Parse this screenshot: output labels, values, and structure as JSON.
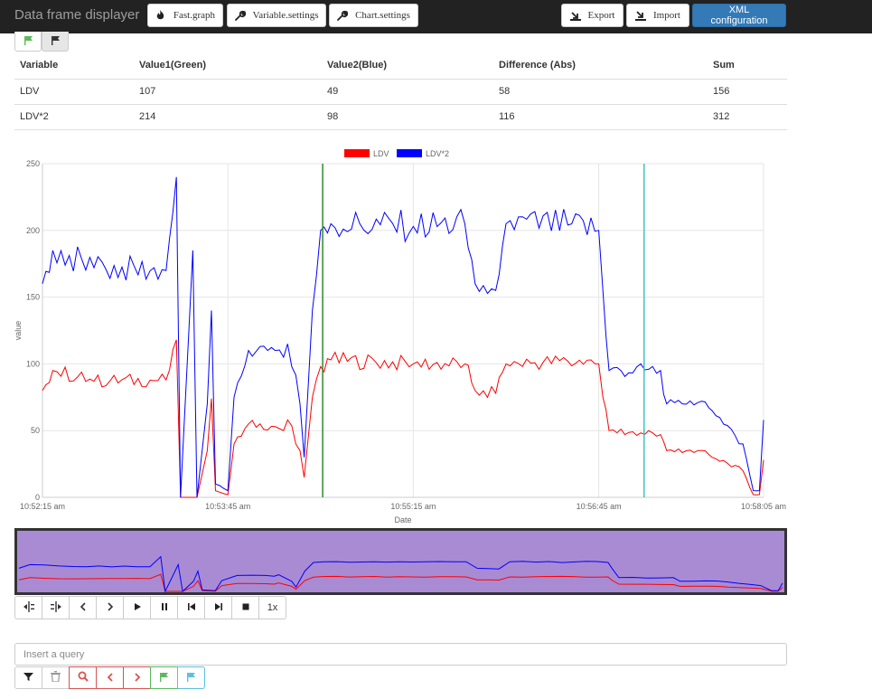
{
  "app": {
    "title": "Data frame displayer"
  },
  "toolbar": {
    "fast_graph": "Fast.graph",
    "variable_settings": "Variable.settings",
    "chart_settings": "Chart.settings",
    "export": "Export",
    "import": "Import",
    "xml_configuration": "XML configuration"
  },
  "table": {
    "headers": [
      "Variable",
      "Value1(Green)",
      "Value2(Blue)",
      "Difference (Abs)",
      "Sum"
    ],
    "rows": [
      [
        "LDV",
        "107",
        "49",
        "58",
        "156"
      ],
      [
        "LDV*2",
        "214",
        "98",
        "116",
        "312"
      ]
    ]
  },
  "chart_data": {
    "type": "line",
    "xlabel": "Date",
    "ylabel": "value",
    "ylim": [
      0,
      250
    ],
    "yticks": [
      0,
      50,
      100,
      150,
      200,
      250
    ],
    "xlim": [
      "10:52:15 am",
      "10:58:05 am"
    ],
    "xticks": [
      "10:52:15 am",
      "10:53:45 am",
      "10:55:15 am",
      "10:56:45 am",
      "10:58:05 am"
    ],
    "legend_position": "top-center",
    "grid": true,
    "colors": {
      "LDV": "#ff0000",
      "LDV*2": "#0000ff",
      "cursor_green": "#2e8b2e",
      "cursor_cyan": "#40c4c4",
      "navigator_bg": "#a98bd4"
    },
    "cursors": {
      "green_x": "10:54:31 am",
      "cyan_x": "10:57:07 am"
    },
    "series": [
      {
        "name": "LDV",
        "points": [
          [
            "10:52:15 am",
            80
          ],
          [
            "10:52:20 am",
            95
          ],
          [
            "10:52:40 am",
            87
          ],
          [
            "10:53:15 am",
            88
          ],
          [
            "10:53:20 am",
            118
          ],
          [
            "10:53:22 am",
            0
          ],
          [
            "10:53:30 am",
            0
          ],
          [
            "10:53:35 am",
            35
          ],
          [
            "10:53:37 am",
            74
          ],
          [
            "10:53:39 am",
            5
          ],
          [
            "10:53:45 am",
            2
          ],
          [
            "10:53:48 am",
            40
          ],
          [
            "10:53:55 am",
            55
          ],
          [
            "10:54:08 am",
            53
          ],
          [
            "10:54:12 am",
            50
          ],
          [
            "10:54:14 am",
            58
          ],
          [
            "10:54:20 am",
            35
          ],
          [
            "10:54:22 am",
            15
          ],
          [
            "10:54:26 am",
            75
          ],
          [
            "10:54:30 am",
            98
          ],
          [
            "10:54:35 am",
            103
          ],
          [
            "10:55:15 am",
            100
          ],
          [
            "10:55:40 am",
            100
          ],
          [
            "10:55:45 am",
            80
          ],
          [
            "10:55:55 am",
            78
          ],
          [
            "10:56:00 am",
            100
          ],
          [
            "10:56:30 am",
            102
          ],
          [
            "10:56:45 am",
            100
          ],
          [
            "10:56:47 am",
            75
          ],
          [
            "10:56:50 am",
            50
          ],
          [
            "10:57:15 am",
            47
          ],
          [
            "10:57:18 am",
            35
          ],
          [
            "10:57:35 am",
            35
          ],
          [
            "10:57:40 am",
            30
          ],
          [
            "10:57:55 am",
            20
          ],
          [
            "10:58:00 am",
            2
          ],
          [
            "10:58:03 am",
            2
          ],
          [
            "10:58:05 am",
            28
          ]
        ]
      },
      {
        "name": "LDV*2",
        "points": [
          [
            "10:52:15 am",
            160
          ],
          [
            "10:52:20 am",
            185
          ],
          [
            "10:52:40 am",
            172
          ],
          [
            "10:53:15 am",
            170
          ],
          [
            "10:53:20 am",
            240
          ],
          [
            "10:53:22 am",
            0
          ],
          [
            "10:53:28 am",
            185
          ],
          [
            "10:53:30 am",
            0
          ],
          [
            "10:53:35 am",
            70
          ],
          [
            "10:53:37 am",
            140
          ],
          [
            "10:53:39 am",
            10
          ],
          [
            "10:53:45 am",
            5
          ],
          [
            "10:53:48 am",
            75
          ],
          [
            "10:53:55 am",
            110
          ],
          [
            "10:54:08 am",
            110
          ],
          [
            "10:54:12 am",
            105
          ],
          [
            "10:54:14 am",
            115
          ],
          [
            "10:54:20 am",
            70
          ],
          [
            "10:54:22 am",
            30
          ],
          [
            "10:54:26 am",
            140
          ],
          [
            "10:54:30 am",
            200
          ],
          [
            "10:54:35 am",
            205
          ],
          [
            "10:55:15 am",
            203
          ],
          [
            "10:55:40 am",
            205
          ],
          [
            "10:55:45 am",
            160
          ],
          [
            "10:55:55 am",
            155
          ],
          [
            "10:56:00 am",
            205
          ],
          [
            "10:56:30 am",
            204
          ],
          [
            "10:56:45 am",
            200
          ],
          [
            "10:56:47 am",
            155
          ],
          [
            "10:56:50 am",
            95
          ],
          [
            "10:57:15 am",
            95
          ],
          [
            "10:57:18 am",
            70
          ],
          [
            "10:57:35 am",
            72
          ],
          [
            "10:57:40 am",
            65
          ],
          [
            "10:57:55 am",
            40
          ],
          [
            "10:58:00 am",
            5
          ],
          [
            "10:58:03 am",
            5
          ],
          [
            "10:58:05 am",
            58
          ]
        ]
      }
    ]
  },
  "player": {
    "speed": "1x"
  },
  "query": {
    "placeholder": "Insert a query"
  }
}
